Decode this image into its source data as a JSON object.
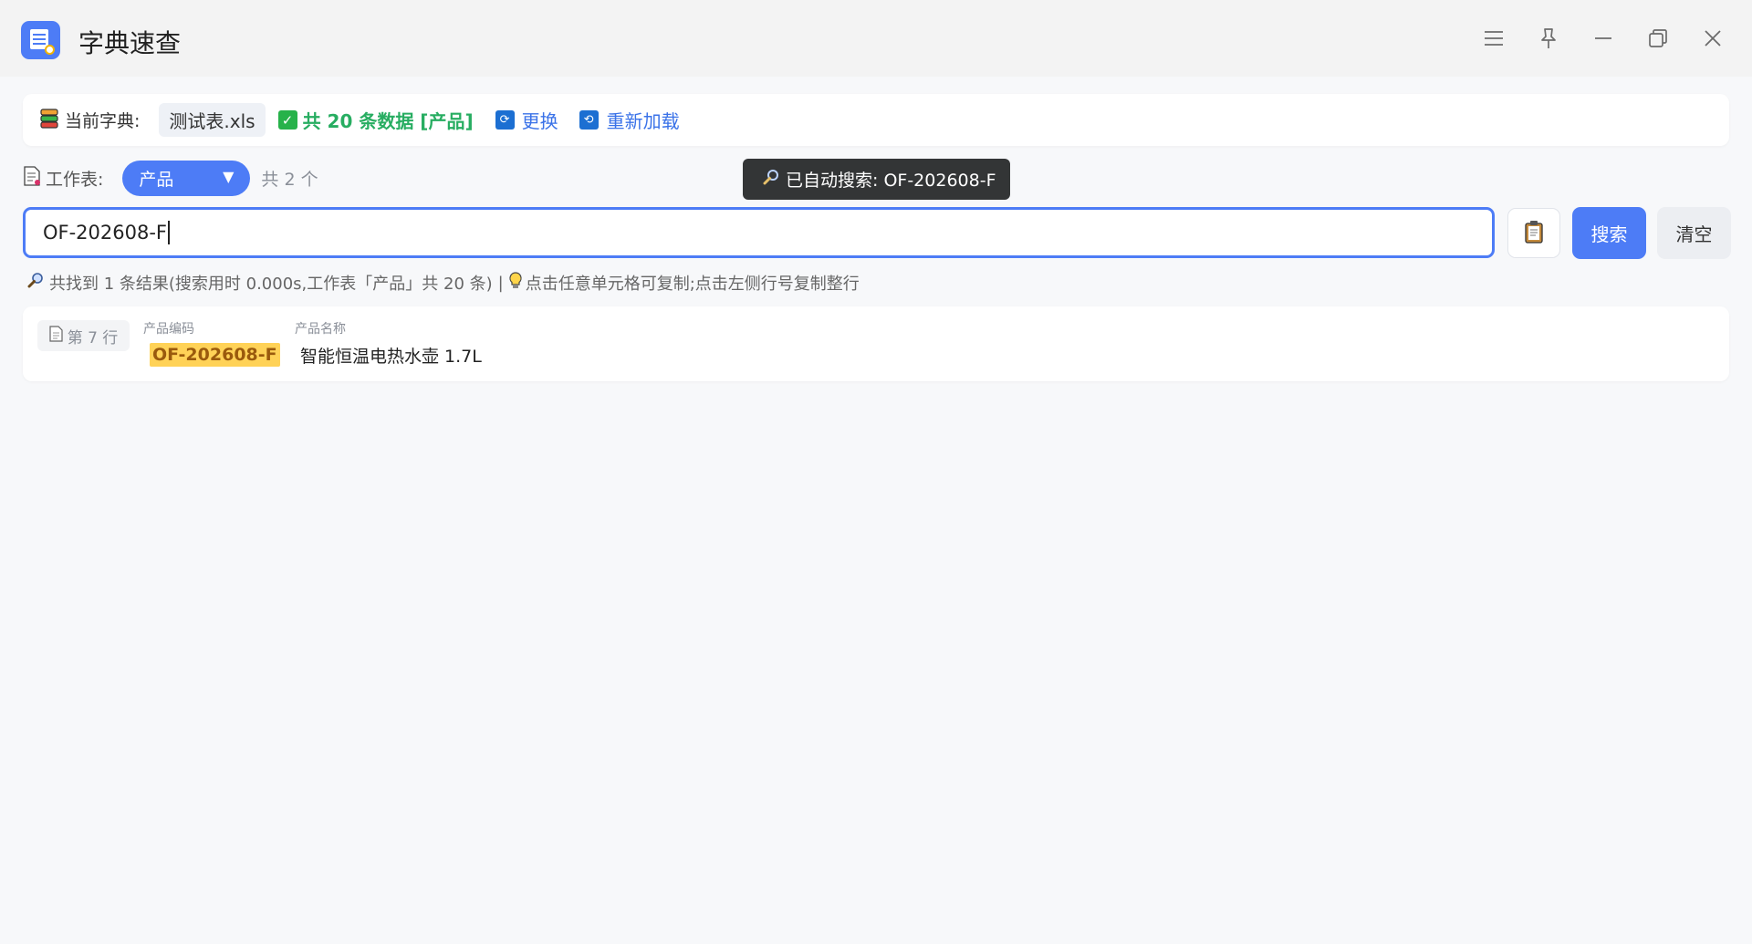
{
  "app": {
    "title": "字典速查"
  },
  "window_controls": {
    "menu": "menu-icon",
    "pin": "pin-icon",
    "minimize": "minimize-icon",
    "restore": "restore-icon",
    "close": "close-icon"
  },
  "dict_bar": {
    "label": "当前字典:",
    "file": "测试表.xls",
    "status": "共 20 条数据 [产品]",
    "change": "更换",
    "reload": "重新加载"
  },
  "sheet": {
    "label": "工作表:",
    "selected": "产品",
    "count": "共 2 个"
  },
  "tooltip": {
    "text": "已自动搜索: OF-202608-F"
  },
  "search": {
    "value": "OF-202608-F",
    "search_label": "搜索",
    "clear_label": "清空"
  },
  "result_info": {
    "summary": "共找到 1 条结果(搜索用时 0.000s,工作表「产品」共 20 条)",
    "separator": "|",
    "hint": "点击任意单元格可复制;点击左侧行号复制整行"
  },
  "results": [
    {
      "row_label": "第 7 行",
      "col1_header": "产品编码",
      "col1_value": "OF-202608-F",
      "col2_header": "产品名称",
      "col2_value": "智能恒温电热水壶 1.7L"
    }
  ],
  "colors": {
    "accent": "#4d7cf6",
    "success": "#27ad61",
    "highlight": "#ffd257"
  }
}
